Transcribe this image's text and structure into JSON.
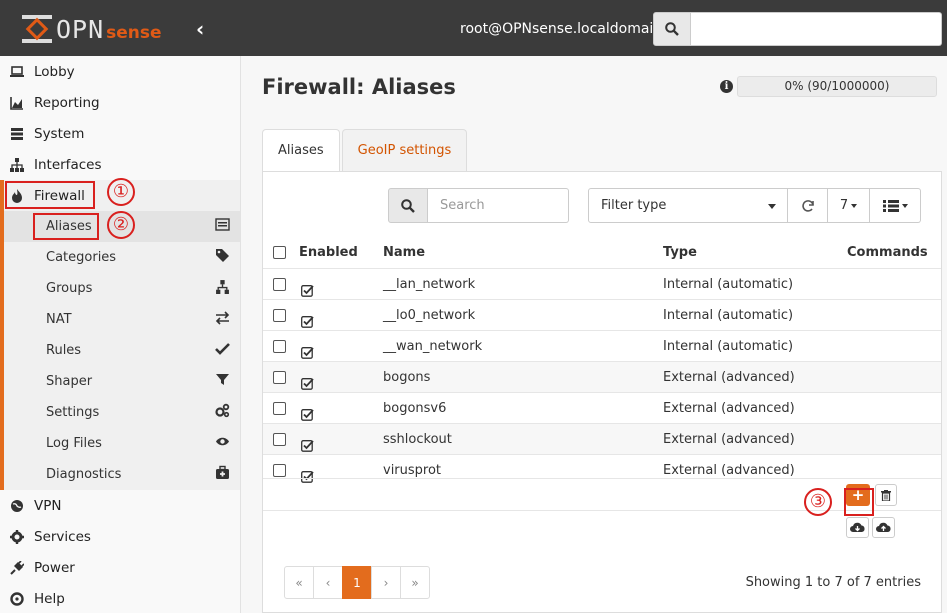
{
  "topbar": {
    "logo_main": "OPN",
    "logo_sense": "sense",
    "user": "root@OPNsense.localdomain",
    "search_placeholder": ""
  },
  "sidebar": {
    "items_top": [
      {
        "label": "Lobby",
        "icon": "laptop-icon"
      },
      {
        "label": "Reporting",
        "icon": "area-chart-icon"
      },
      {
        "label": "System",
        "icon": "server-icon"
      },
      {
        "label": "Interfaces",
        "icon": "sitemap-icon"
      }
    ],
    "firewall": {
      "label": "Firewall",
      "icon": "fire-icon",
      "subitems": [
        {
          "label": "Aliases",
          "icon": "list-alt-icon"
        },
        {
          "label": "Categories",
          "icon": "tags-icon"
        },
        {
          "label": "Groups",
          "icon": "sitemap-icon"
        },
        {
          "label": "NAT",
          "icon": "exchange-icon"
        },
        {
          "label": "Rules",
          "icon": "check-icon"
        },
        {
          "label": "Shaper",
          "icon": "filter-icon"
        },
        {
          "label": "Settings",
          "icon": "cogs-icon"
        },
        {
          "label": "Log Files",
          "icon": "eye-icon"
        },
        {
          "label": "Diagnostics",
          "icon": "medkit-icon"
        }
      ]
    },
    "items_bottom": [
      {
        "label": "VPN",
        "icon": "globe-icon"
      },
      {
        "label": "Services",
        "icon": "cog-icon"
      },
      {
        "label": "Power",
        "icon": "plug-icon"
      },
      {
        "label": "Help",
        "icon": "support-icon"
      }
    ]
  },
  "main": {
    "title": "Firewall: Aliases",
    "progress_text": "0% (90/1000000)",
    "progress_value": 0,
    "tabs": [
      {
        "label": "Aliases",
        "active": true
      },
      {
        "label": "GeoIP settings",
        "active": false
      }
    ],
    "toolbar": {
      "search_placeholder": "Search",
      "filter_label": "Filter type",
      "rows_per_page": "7"
    },
    "table": {
      "headers": {
        "enabled": "Enabled",
        "name": "Name",
        "type": "Type",
        "commands": "Commands"
      },
      "rows": [
        {
          "name": "__lan_network",
          "type": "Internal (automatic)",
          "enabled": true
        },
        {
          "name": "__lo0_network",
          "type": "Internal (automatic)",
          "enabled": true
        },
        {
          "name": "__wan_network",
          "type": "Internal (automatic)",
          "enabled": true
        },
        {
          "name": "bogons",
          "type": "External (advanced)",
          "enabled": true
        },
        {
          "name": "bogonsv6",
          "type": "External (advanced)",
          "enabled": true
        },
        {
          "name": "sshlockout",
          "type": "External (advanced)",
          "enabled": true
        },
        {
          "name": "virusprot",
          "type": "External (advanced)",
          "enabled": true
        }
      ]
    },
    "add_label": "+",
    "pagination": {
      "first": "«",
      "prev": "‹",
      "current": "1",
      "next": "›",
      "last": "»"
    },
    "showing_text": "Showing 1 to 7 of 7 entries"
  },
  "annotations": [
    "①",
    "②",
    "③"
  ],
  "colors": {
    "accent": "#e36c1d",
    "annotation": "#d9201e",
    "topbar": "#3b3b3b"
  }
}
